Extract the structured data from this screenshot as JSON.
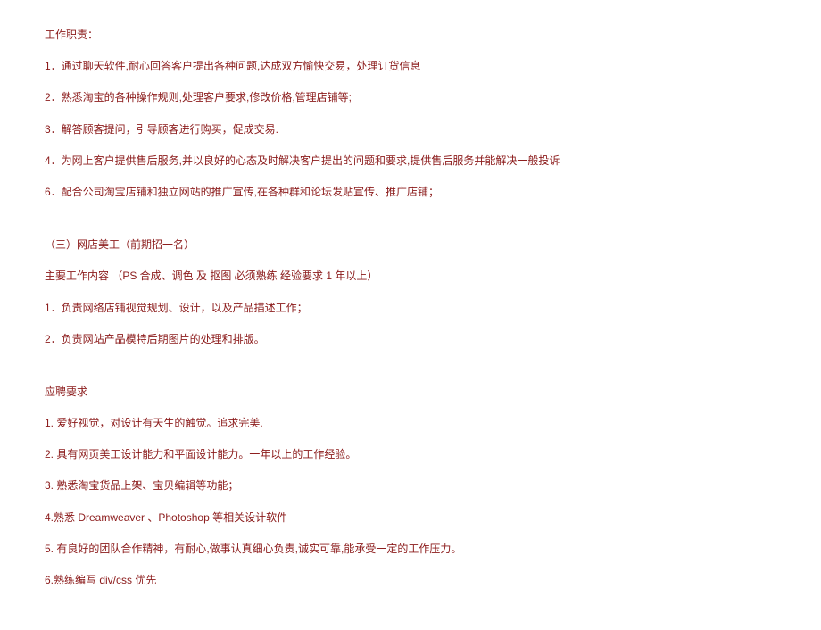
{
  "section1": {
    "heading": "工作职责：",
    "items": [
      "1．通过聊天软件,耐心回答客户提出各种问题,达成双方愉快交易，处理订货信息",
      "2．熟悉淘宝的各种操作规则,处理客户要求,修改价格,管理店铺等;",
      "3．解答顾客提问，引导顾客进行购买，促成交易.",
      "4．为网上客户提供售后服务,并以良好的心态及时解决客户提出的问题和要求,提供售后服务并能解决一般投诉",
      "6．配合公司淘宝店铺和独立网站的推广宣传,在各种群和论坛发贴宣传、推广店铺；"
    ]
  },
  "section2": {
    "heading": "（三）网店美工（前期招一名）",
    "intro": "主要工作内容  （PS 合成、调色  及  抠图  必须熟练   经验要求  1 年以上）",
    "items": [
      "1．负责网络店铺视觉规划、设计，以及产品描述工作；",
      "2．负责网站产品模特后期图片的处理和排版。"
    ]
  },
  "section3": {
    "heading": "应聘要求",
    "items": [
      "1.        爱好视觉，对设计有天生的触觉。追求完美.",
      "2.        具有网页美工设计能力和平面设计能力。一年以上的工作经验。",
      "3.    熟悉淘宝货品上架、宝贝编辑等功能；",
      "4.熟悉  Dreamweaver 、Photoshop 等相关设计软件",
      "5.        有良好的团队合作精神，有耐心,做事认真细心负责,诚实可靠,能承受一定的工作压力。",
      "6.熟练编写  div/css 优先"
    ]
  }
}
